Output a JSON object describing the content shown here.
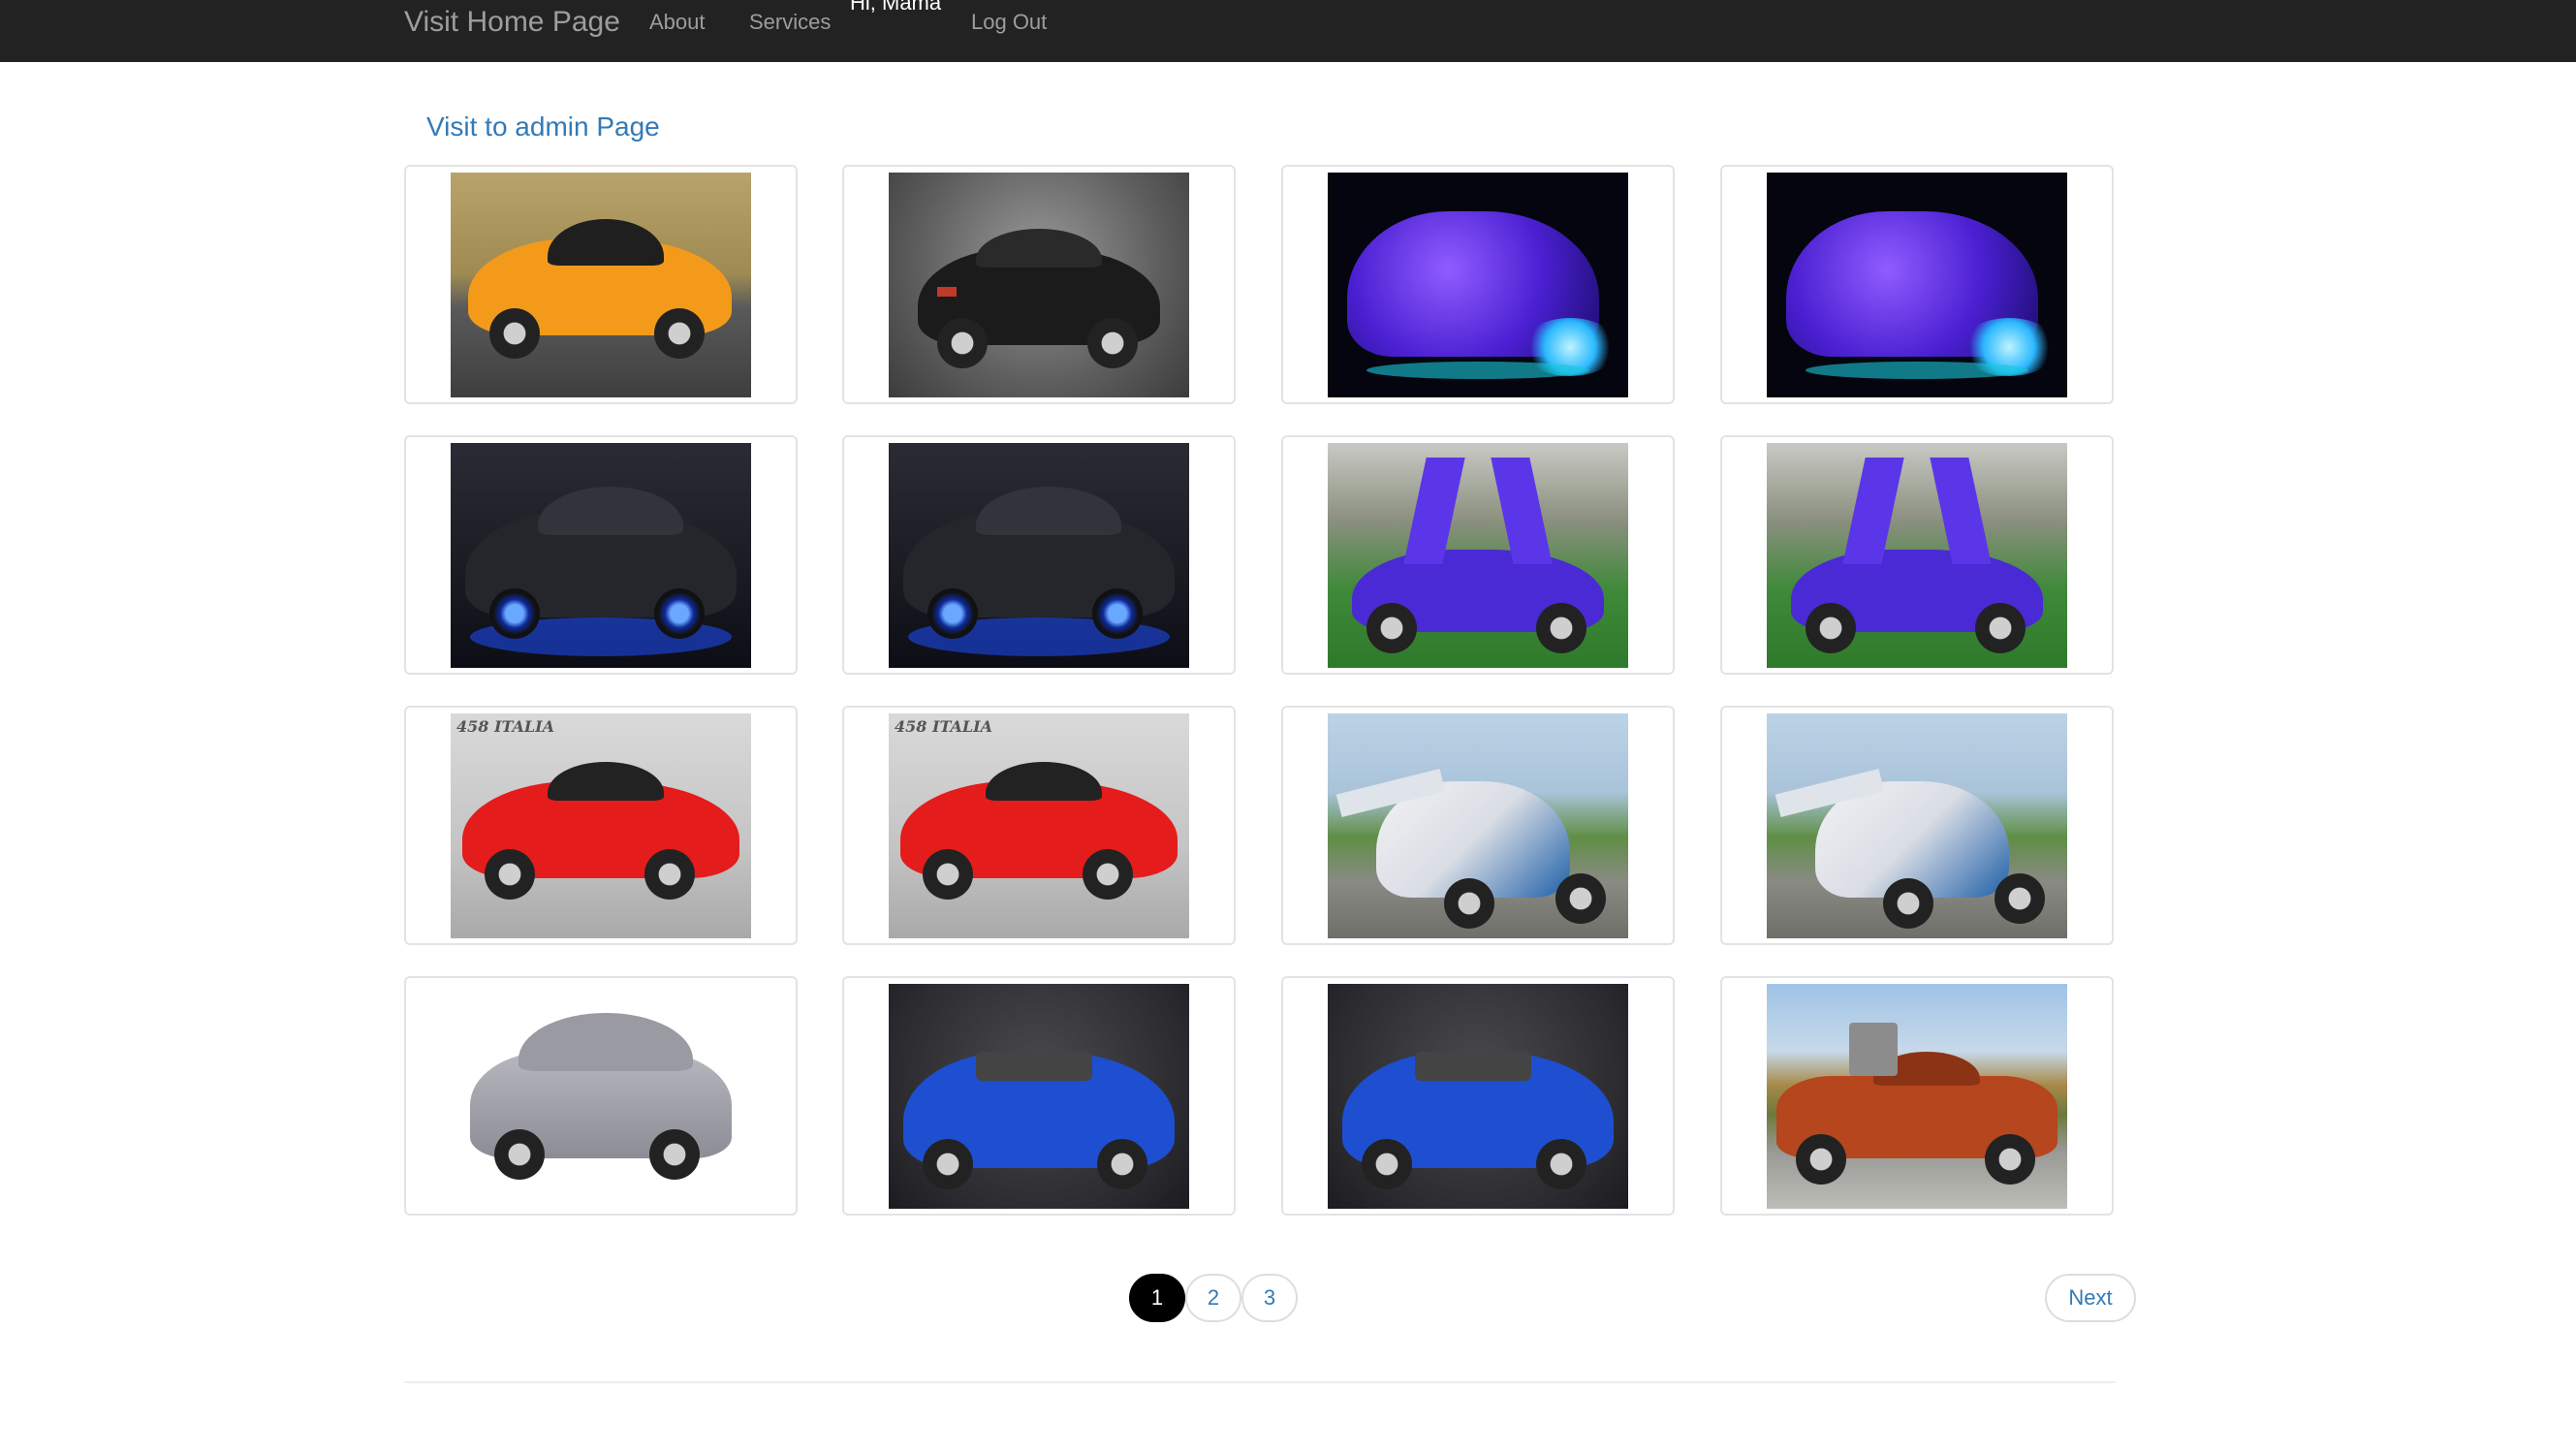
{
  "nav": {
    "brand": "Visit Home Page",
    "about": "About",
    "services": "Services",
    "greeting": "Hi, Mama",
    "logout": "Log Out"
  },
  "admin_link": "Visit to admin Page",
  "gallery": {
    "items": [
      {
        "icon": "orange-sports-car-image"
      },
      {
        "icon": "black-camaro-image"
      },
      {
        "icon": "purple-neon-car-image"
      },
      {
        "icon": "purple-neon-car-image"
      },
      {
        "icon": "black-mustang-blue-lights-image"
      },
      {
        "icon": "black-mustang-blue-lights-image"
      },
      {
        "icon": "purple-supercar-doors-open-image"
      },
      {
        "icon": "purple-supercar-doors-open-image"
      },
      {
        "icon": "red-ferrari-458-image",
        "caption": "458 ITALIA"
      },
      {
        "icon": "red-ferrari-458-image",
        "caption": "458 ITALIA"
      },
      {
        "icon": "flying-car-image"
      },
      {
        "icon": "flying-car-image"
      },
      {
        "icon": "silver-suv-image"
      },
      {
        "icon": "blue-convertible-image"
      },
      {
        "icon": "blue-convertible-image"
      },
      {
        "icon": "orange-muscle-car-image"
      }
    ]
  },
  "pagination": {
    "pages": [
      "1",
      "2",
      "3"
    ],
    "active": "1",
    "next": "Next"
  },
  "colors": {
    "navbar": "#222222",
    "link": "#337ab7",
    "active_page": "#000000"
  }
}
